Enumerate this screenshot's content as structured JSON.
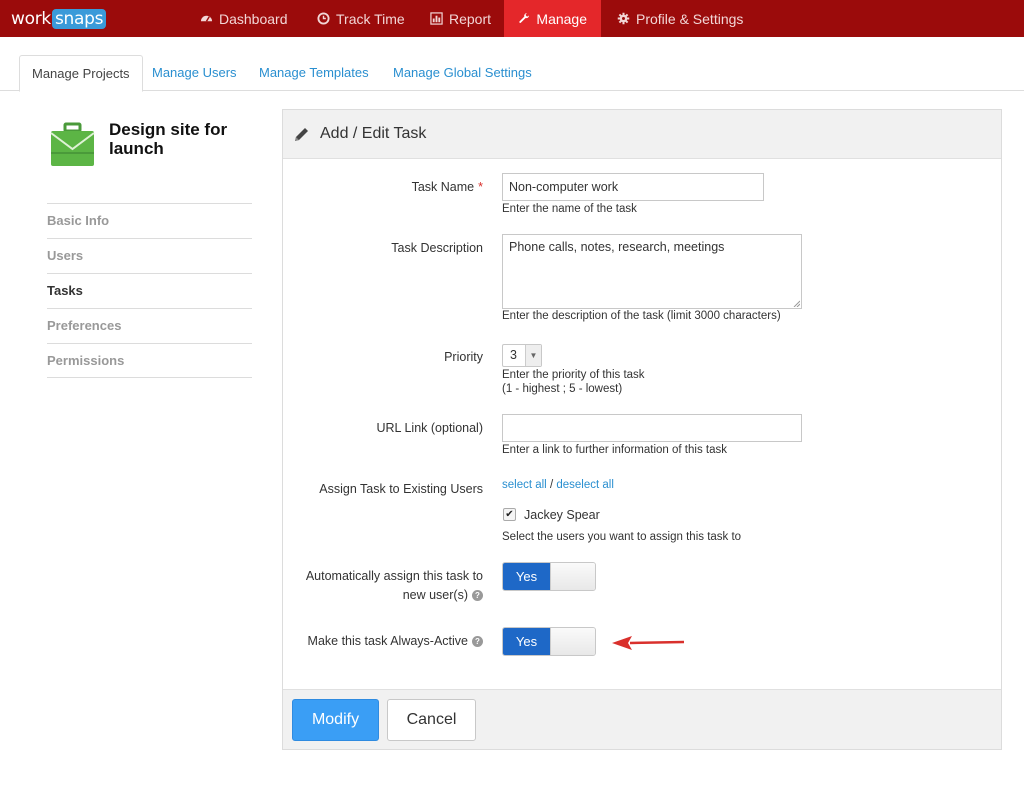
{
  "logo": {
    "work": "work",
    "snaps": "snaps"
  },
  "nav": [
    {
      "label": "Dashboard",
      "icon": "dashboard-icon"
    },
    {
      "label": "Track Time",
      "icon": "clock-icon"
    },
    {
      "label": "Report",
      "icon": "bar-chart-icon"
    },
    {
      "label": "Manage",
      "icon": "wrench-icon",
      "active": true
    },
    {
      "label": "Profile & Settings",
      "icon": "gear-icon"
    }
  ],
  "tabs": [
    {
      "label": "Manage Projects",
      "active": true
    },
    {
      "label": "Manage Users"
    },
    {
      "label": "Manage Templates"
    },
    {
      "label": "Manage Global Settings"
    }
  ],
  "sidebar": {
    "project_title": "Design site for launch",
    "items": [
      {
        "label": "Basic Info"
      },
      {
        "label": "Users"
      },
      {
        "label": "Tasks",
        "active": true
      },
      {
        "label": "Preferences"
      },
      {
        "label": "Permissions"
      }
    ]
  },
  "panel": {
    "title": "Add / Edit Task",
    "task_name": {
      "label": "Task Name",
      "required_mark": "*",
      "value": "Non-computer work",
      "help": "Enter the name of the task"
    },
    "task_description": {
      "label": "Task Description",
      "value": "Phone calls, notes, research, meetings",
      "help": "Enter the description of the task (limit 3000 characters)"
    },
    "priority": {
      "label": "Priority",
      "value": "3",
      "help_line1": "Enter the priority of this task",
      "help_line2": "(1 - highest ; 5 - lowest)"
    },
    "url_link": {
      "label": "URL Link (optional)",
      "value": "",
      "help": "Enter a link to further information of this task"
    },
    "assign": {
      "label": "Assign Task to Existing Users",
      "select_all": "select all",
      "separator": "/",
      "deselect_all": "deselect all",
      "users": [
        {
          "name": "Jackey Spear",
          "checked": true
        }
      ],
      "help": "Select the users you want to assign this task to"
    },
    "auto_assign": {
      "label_line1": "Automatically assign this task to",
      "label_line2": "new user(s)",
      "toggle_label": "Yes"
    },
    "always_active": {
      "label": "Make this task Always-Active",
      "toggle_label": "Yes"
    },
    "buttons": {
      "modify": "Modify",
      "cancel": "Cancel"
    }
  },
  "colors": {
    "topbar": "#9b0b0b",
    "nav_active": "#e4272a",
    "link": "#2a8fd0",
    "primary_button": "#3a9ef5",
    "toggle_on": "#1e68c7",
    "annotation_arrow": "#d9302c"
  }
}
